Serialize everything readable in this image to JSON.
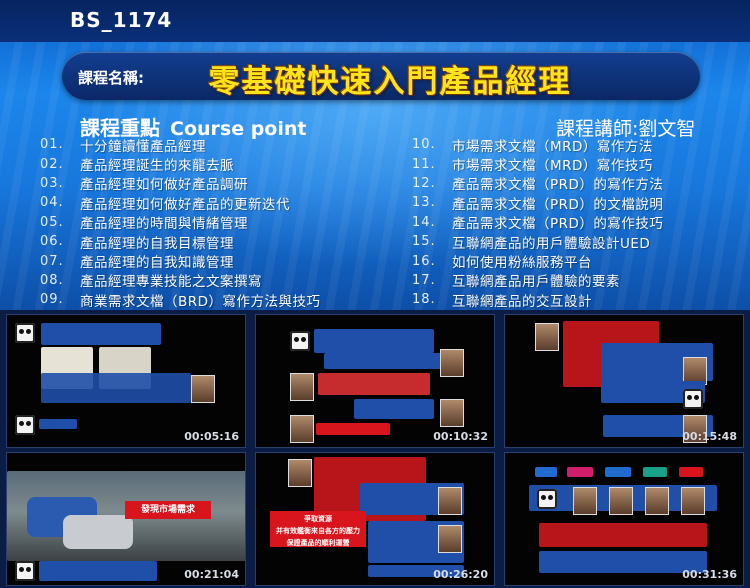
{
  "header": {
    "code": "BS_1174",
    "course_label": "課程名稱:",
    "course_title": "零基礎快速入門產品經理"
  },
  "section": {
    "title_cn": "課程重點",
    "title_en": "Course point",
    "lecturer": "課程講師:劉文智"
  },
  "points_left": [
    {
      "num": "01.",
      "text": "十分鐘讀懂產品經理"
    },
    {
      "num": "02.",
      "text": "產品經理誕生的來龍去脈"
    },
    {
      "num": "03.",
      "text": "產品經理如何做好產品調研"
    },
    {
      "num": "04.",
      "text": "產品經理如何做好產品的更新迭代"
    },
    {
      "num": "05.",
      "text": "產品經理的時間與情緒管理"
    },
    {
      "num": "06.",
      "text": "產品經理的自我目標管理"
    },
    {
      "num": "07.",
      "text": "產品經理的自我知識管理"
    },
    {
      "num": "08.",
      "text": "產品經理專業技能之文案撰寫"
    },
    {
      "num": "09.",
      "text": "商業需求文檔（BRD）寫作方法與技巧"
    }
  ],
  "points_right": [
    {
      "num": "10.",
      "text": "市場需求文檔（MRD）寫作方法"
    },
    {
      "num": "11.",
      "text": "市場需求文檔（MRD）寫作技巧"
    },
    {
      "num": "12.",
      "text": "產品需求文檔（PRD）的寫作方法"
    },
    {
      "num": "13.",
      "text": "產品需求文檔（PRD）的文檔說明"
    },
    {
      "num": "14.",
      "text": "產品需求文檔（PRD）的寫作技巧"
    },
    {
      "num": "15.",
      "text": "互聯網產品的用戶體驗設計UED"
    },
    {
      "num": "16.",
      "text": "如何使用粉絲服務平台"
    },
    {
      "num": "17.",
      "text": "互聯網產品用戶體驗的要素"
    },
    {
      "num": "18.",
      "text": "互聯網產品的交互設計"
    }
  ],
  "thumbnails": [
    {
      "timestamp": "00:05:16"
    },
    {
      "timestamp": "00:10:32"
    },
    {
      "timestamp": "00:15:48"
    },
    {
      "timestamp": "00:21:04",
      "caption": "發現市場需求"
    },
    {
      "timestamp": "00:26:20",
      "caption": "爭取資源 \n 并有效鑑衡來自各方的壓力\n保證產品的順利運營"
    },
    {
      "timestamp": "00:31:36"
    }
  ],
  "colors": {
    "title_yellow": "#ffe419",
    "header_bar": "#0a2f7a",
    "thumb_red": "#d8151c",
    "thumb_blue": "#1f4fa8"
  }
}
